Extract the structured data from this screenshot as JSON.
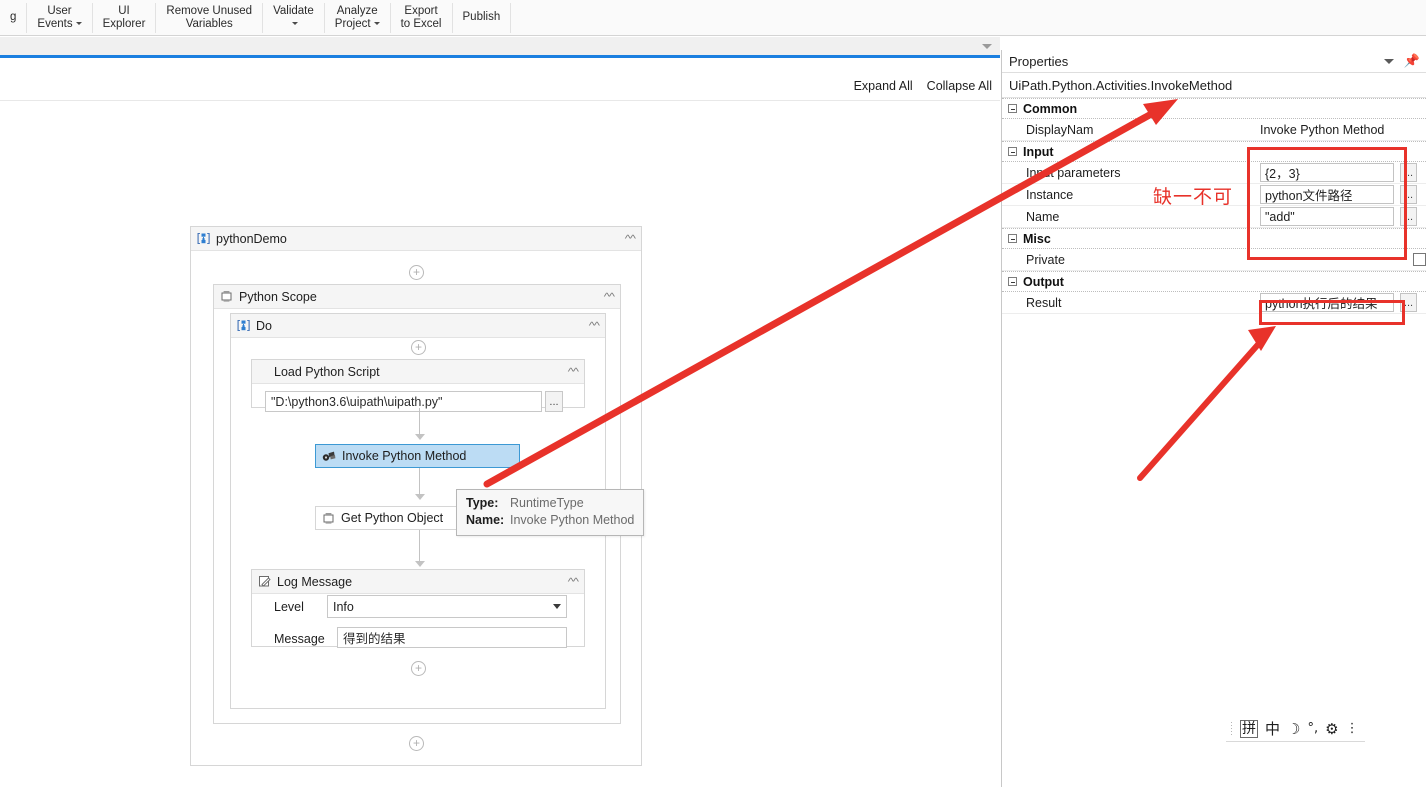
{
  "ribbon": {
    "items": [
      {
        "line1": "g",
        "line2": "",
        "caret": false
      },
      {
        "line1": "User",
        "line2": "Events",
        "caret": true
      },
      {
        "line1": "UI",
        "line2": "Explorer",
        "caret": false
      },
      {
        "line1": "Remove Unused",
        "line2": "Variables",
        "caret": false
      },
      {
        "line1": "Validate",
        "line2": "",
        "caret": true
      },
      {
        "line1": "Analyze",
        "line2": "Project",
        "caret": true
      },
      {
        "line1": "Export",
        "line2": "to Excel",
        "caret": false
      },
      {
        "line1": "Publish",
        "line2": "",
        "caret": false
      }
    ]
  },
  "designer": {
    "expand_all": "Expand All",
    "collapse_all": "Collapse All",
    "root_sequence": {
      "title": "pythonDemo",
      "icon": "sequence-icon"
    },
    "python_scope": {
      "title": "Python Scope",
      "icon": "python-scope-icon"
    },
    "do_sequence": {
      "title": "Do",
      "icon": "sequence-icon"
    },
    "load_python_script": {
      "title": "Load Python Script",
      "value": "\"D:\\python3.6\\uipath\\uipath.py\"",
      "ellipsis": "..."
    },
    "invoke_python_method": {
      "title": "Invoke Python Method",
      "icon": "invoke-method-icon",
      "selected": true
    },
    "get_python_object": {
      "title": "Get Python Object",
      "icon": "python-object-icon"
    },
    "log_message": {
      "title": "Log Message",
      "icon": "log-message-icon",
      "level_label": "Level",
      "level_value": "Info",
      "message_label": "Message",
      "message_value": "得到的结果"
    },
    "tooltip": {
      "type_label": "Type:",
      "type_value": "RuntimeType",
      "name_label": "Name:",
      "name_value": "Invoke Python Method"
    }
  },
  "properties": {
    "panel_title": "Properties",
    "type_name": "UiPath.Python.Activities.InvokeMethod",
    "categories": [
      {
        "name": "Common",
        "rows": [
          {
            "name": "DisplayNam",
            "value": "Invoke Python Method",
            "kind": "text"
          }
        ]
      },
      {
        "name": "Input",
        "rows": [
          {
            "name": "Input parameters",
            "value": "{2，3}",
            "kind": "editor",
            "ellipsis": "..."
          },
          {
            "name": "Instance",
            "value": "python文件路径",
            "kind": "editor",
            "ellipsis": "..."
          },
          {
            "name": "Name",
            "value": "\"add\"",
            "kind": "editor",
            "ellipsis": "..."
          }
        ]
      },
      {
        "name": "Misc",
        "rows": [
          {
            "name": "Private",
            "value": "",
            "kind": "checkbox"
          }
        ]
      },
      {
        "name": "Output",
        "rows": [
          {
            "name": "Result",
            "value": "python执行后的结果",
            "kind": "editor",
            "ellipsis": "..."
          }
        ]
      }
    ]
  },
  "annotations": {
    "note_text": "缺一不可",
    "highlight_color": "#e8322a",
    "arrow_color": "#e8322a"
  },
  "ime_toolbar": {
    "mode_pin": "拼",
    "lang": "中",
    "moon": "☽",
    "punct": "°,",
    "gear": "⚙",
    "more": "⋮"
  }
}
